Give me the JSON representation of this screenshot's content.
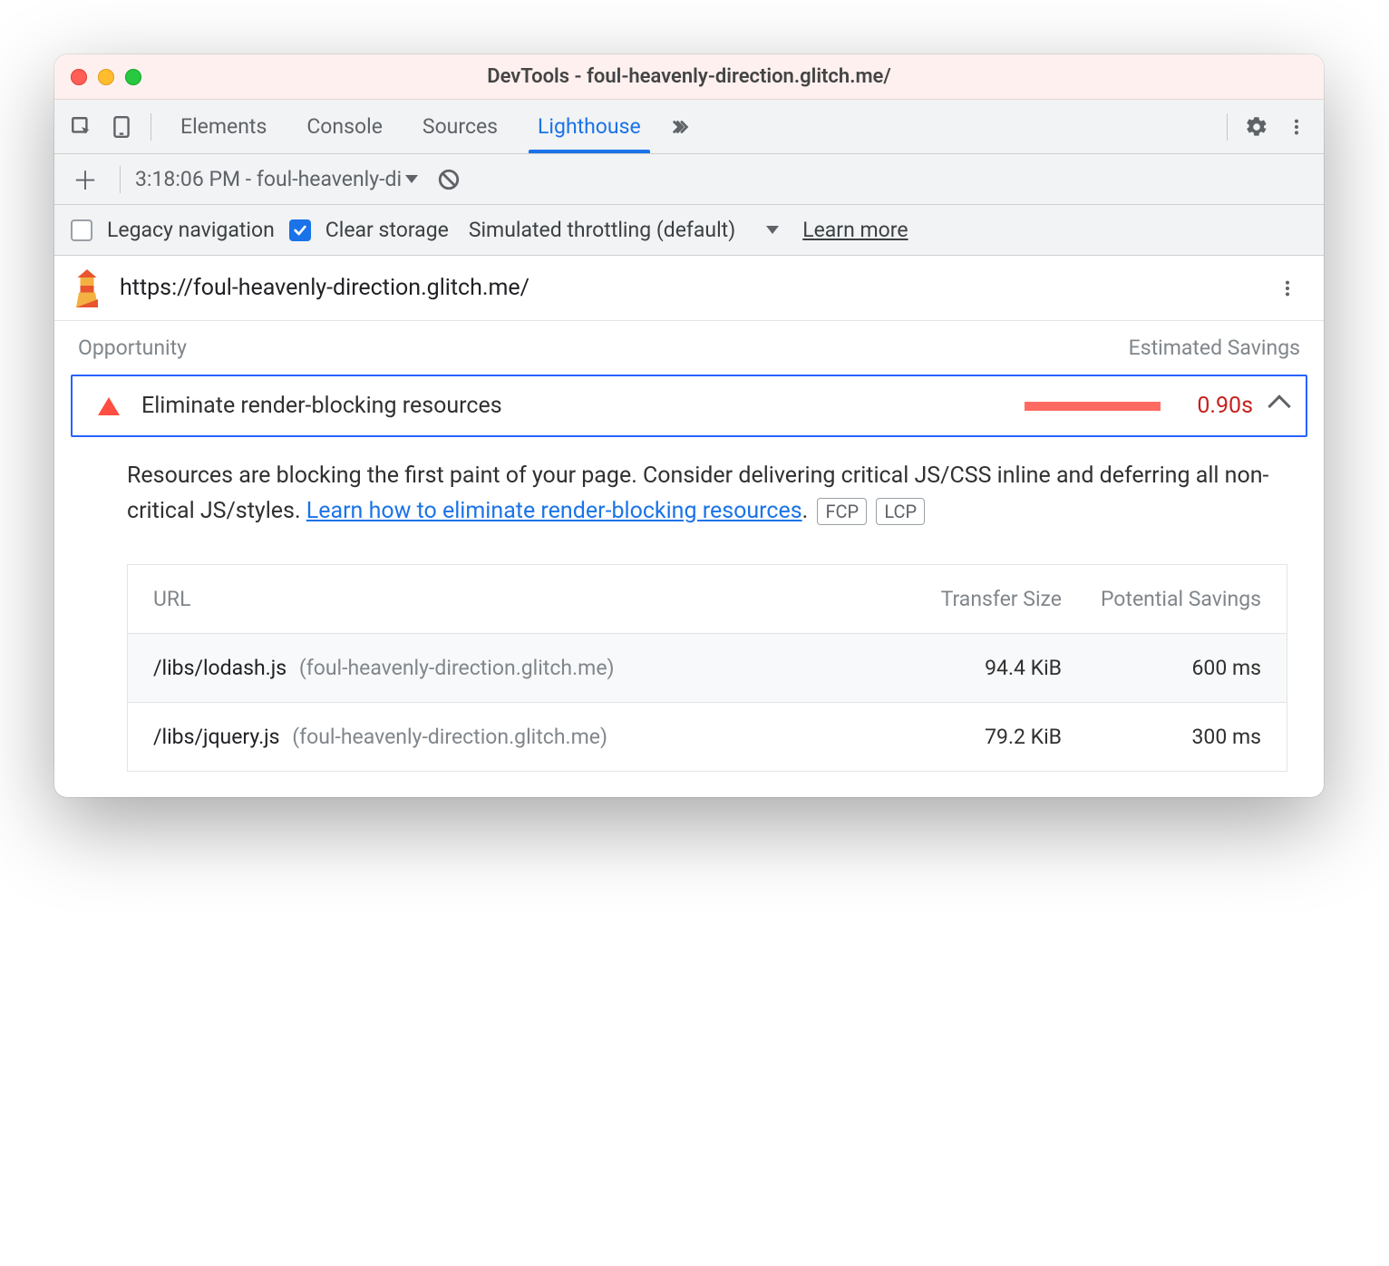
{
  "window": {
    "title": "DevTools - foul-heavenly-direction.glitch.me/"
  },
  "tabs": [
    "Elements",
    "Console",
    "Sources",
    "Lighthouse"
  ],
  "active_tab_index": 3,
  "toolbar": {
    "report_select": "3:18:06 PM - foul-heavenly-di"
  },
  "options": {
    "legacy_label": "Legacy navigation",
    "legacy_checked": false,
    "clear_label": "Clear storage",
    "clear_checked": true,
    "throttling_label": "Simulated throttling (default)",
    "learn_more": "Learn more"
  },
  "lighthouse": {
    "url": "https://foul-heavenly-direction.glitch.me/",
    "cols": {
      "opportunity": "Opportunity",
      "savings": "Estimated Savings"
    }
  },
  "audit": {
    "title": "Eliminate render-blocking resources",
    "value": "0.90s",
    "description_prefix": "Resources are blocking the first paint of your page. Consider delivering critical JS/CSS inline and deferring all non-critical JS/styles. ",
    "link_text": "Learn how to eliminate render-blocking resources",
    "description_suffix": ".",
    "badges": [
      "FCP",
      "LCP"
    ]
  },
  "table": {
    "headers": {
      "url": "URL",
      "size": "Transfer Size",
      "savings": "Potential Savings"
    },
    "rows": [
      {
        "path": "/libs/lodash.js",
        "host": "(foul-heavenly-direction.glitch.me)",
        "size": "94.4 KiB",
        "savings": "600 ms"
      },
      {
        "path": "/libs/jquery.js",
        "host": "(foul-heavenly-direction.glitch.me)",
        "size": "79.2 KiB",
        "savings": "300 ms"
      }
    ]
  }
}
